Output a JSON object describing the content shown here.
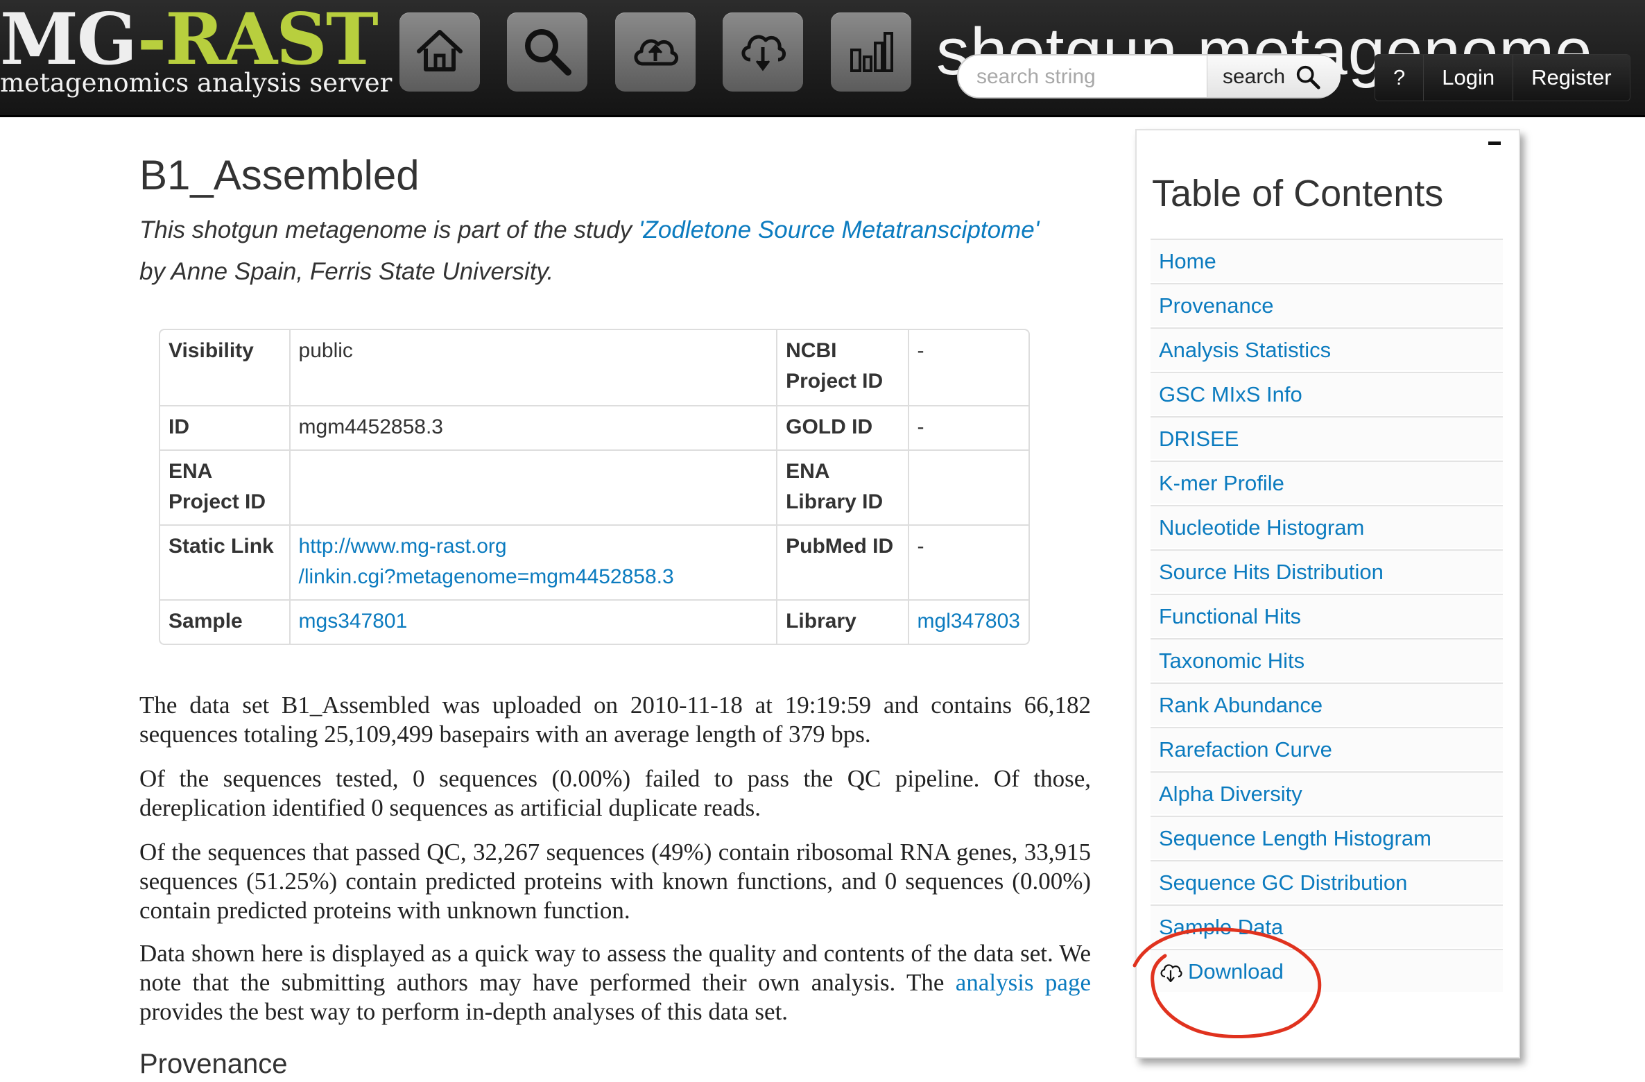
{
  "header": {
    "logo_main": "MG",
    "logo_dash": "-",
    "logo_accent": "RAST",
    "logo_subtitle": "metagenomics analysis server",
    "background_title": "shotgun metagenome",
    "search_placeholder": "search string",
    "search_button_label": "search",
    "help_label": "?",
    "login_label": "Login",
    "register_label": "Register",
    "nav_icons": [
      "home-icon",
      "search-icon",
      "upload-icon",
      "download-icon",
      "bar-chart-icon"
    ]
  },
  "main": {
    "title": "B1_Assembled",
    "subtitle_prefix": "This shotgun metagenome is part of the study ",
    "study_link": "'Zodletone Source Metatransciptome'",
    "subtitle_suffix": "by Anne Spain, Ferris State University.",
    "metadata": {
      "visibility_label": "Visibility",
      "visibility_value": "public",
      "ncbi_label_1": "NCBI",
      "ncbi_label_2": "Project ID",
      "ncbi_value": "-",
      "id_label": "ID",
      "id_value": "mgm4452858.3",
      "gold_label": "GOLD ID",
      "gold_value": "-",
      "ena_project_label_1": "ENA",
      "ena_project_label_2": "Project ID",
      "ena_project_value": "",
      "ena_library_label_1": "ENA",
      "ena_library_label_2": "Library ID",
      "ena_library_value": "",
      "static_link_label": "Static Link",
      "static_link_line1": "http://www.mg-rast.org",
      "static_link_line2": "/linkin.cgi?metagenome=mgm4452858.3",
      "pubmed_label": "PubMed ID",
      "pubmed_value": "-",
      "sample_label": "Sample",
      "sample_value": "mgs347801",
      "library_label": "Library",
      "library_value": "mgl347803"
    },
    "paragraph1": "The data set B1_Assembled was uploaded on 2010-11-18 at 19:19:59 and contains 66,182 sequences totaling 25,109,499 basepairs with an average length of 379 bps.",
    "paragraph2": "Of the sequences tested, 0 sequences (0.00%) failed to pass the QC pipeline. Of those, dereplication identified 0 sequences as artificial duplicate reads.",
    "paragraph3": "Of the sequences that passed QC, 32,267 sequences (49%) contain ribosomal RNA genes, 33,915 sequences (51.25%) contain predicted proteins with known functions, and 0 sequences (0.00%) contain predicted proteins with unknown function.",
    "paragraph4_prefix": "Data shown here is displayed as a quick way to assess the quality and contents of the data set. We note that the submitting authors may have performed their own analysis. The ",
    "paragraph4_link": "analysis page",
    "paragraph4_suffix": " provides the best way to perform in-depth analyses of this data set.",
    "provenance_heading": "Provenance"
  },
  "toc": {
    "collapse_label": "-",
    "title": "Table of Contents",
    "items": [
      "Home",
      "Provenance",
      "Analysis Statistics",
      "GSC MIxS Info",
      "DRISEE",
      "K-mer Profile",
      "Nucleotide Histogram",
      "Source Hits Distribution",
      "Functional Hits",
      "Taxonomic Hits",
      "Rank Abundance",
      "Rarefaction Curve",
      "Alpha Diversity",
      "Sequence Length Histogram",
      "Sequence GC Distribution",
      "Sample Data",
      "Download"
    ],
    "download_icon": "cloud-download-icon"
  },
  "colors": {
    "link": "#0b7bbf",
    "logo_accent": "#b8cf3e",
    "header_bg": "#1e1e1e",
    "annotation_circle": "#e0321e"
  }
}
